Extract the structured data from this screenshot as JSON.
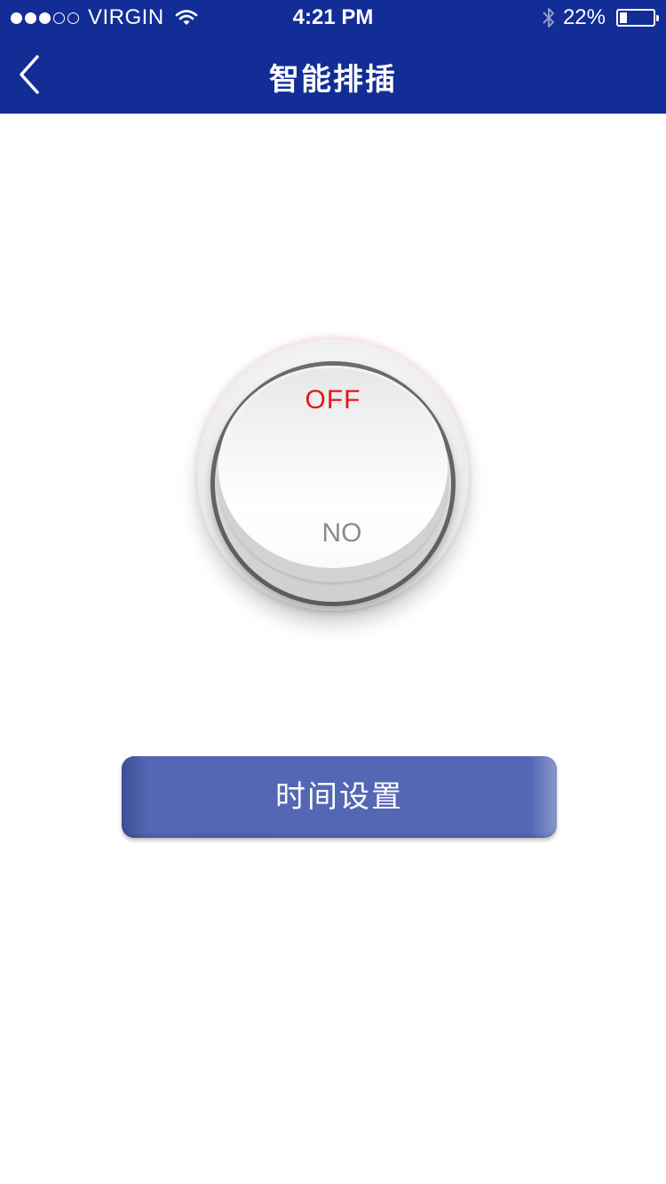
{
  "status_bar": {
    "carrier": "VIRGIN",
    "time": "4:21 PM",
    "battery_percent": "22%",
    "battery_level": 0.22,
    "signal_icons": [
      "signal-dot-filled",
      "signal-dot-filled",
      "signal-dot-filled",
      "signal-dot-empty",
      "signal-dot-empty"
    ]
  },
  "nav": {
    "title": "智能排插",
    "back_icon": "chevron-left-icon"
  },
  "switch": {
    "off_label": "OFF",
    "on_label": "NO",
    "state": "off"
  },
  "timer_button": {
    "label": "时间设置"
  },
  "colors": {
    "header_bg": "#132d96",
    "button_bg": "#5467b6",
    "off_color": "#e8161c",
    "on_color": "#8a8a8a"
  }
}
